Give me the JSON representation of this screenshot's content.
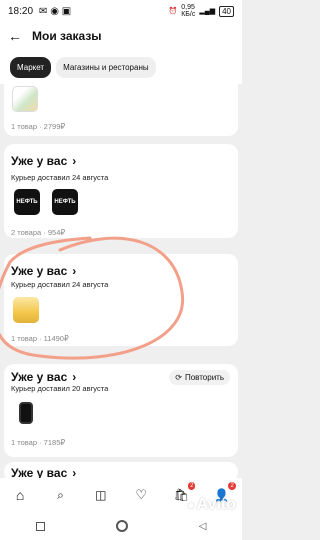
{
  "status": {
    "time": "18:20",
    "net": "0,95\nКБ/с",
    "battery": "40"
  },
  "header": {
    "title": "Мои заказы"
  },
  "tabs": [
    {
      "label": "Маркет",
      "active": true
    },
    {
      "label": "Магазины и рестораны",
      "active": false
    }
  ],
  "orders": [
    {
      "title": "",
      "subtitle": "",
      "info": "1 товар · 2799₽"
    },
    {
      "title": "Уже у вас",
      "subtitle": "Курьер доставил 24 августа",
      "info": "2 товара · 954₽"
    },
    {
      "title": "Уже у вас",
      "subtitle": "Курьер доставил 24 августа",
      "info": "1 товар · 11490₽"
    },
    {
      "title": "Уже у вас",
      "subtitle": "Курьер доставил 20 августа",
      "info": "1 товар · 7185₽",
      "action": "Повторить"
    },
    {
      "title": "Уже у вас"
    }
  ],
  "thumb_text": "НЕФТЬ",
  "colors": {
    "accent": "#e53935",
    "annotation": "#f3a08a"
  }
}
